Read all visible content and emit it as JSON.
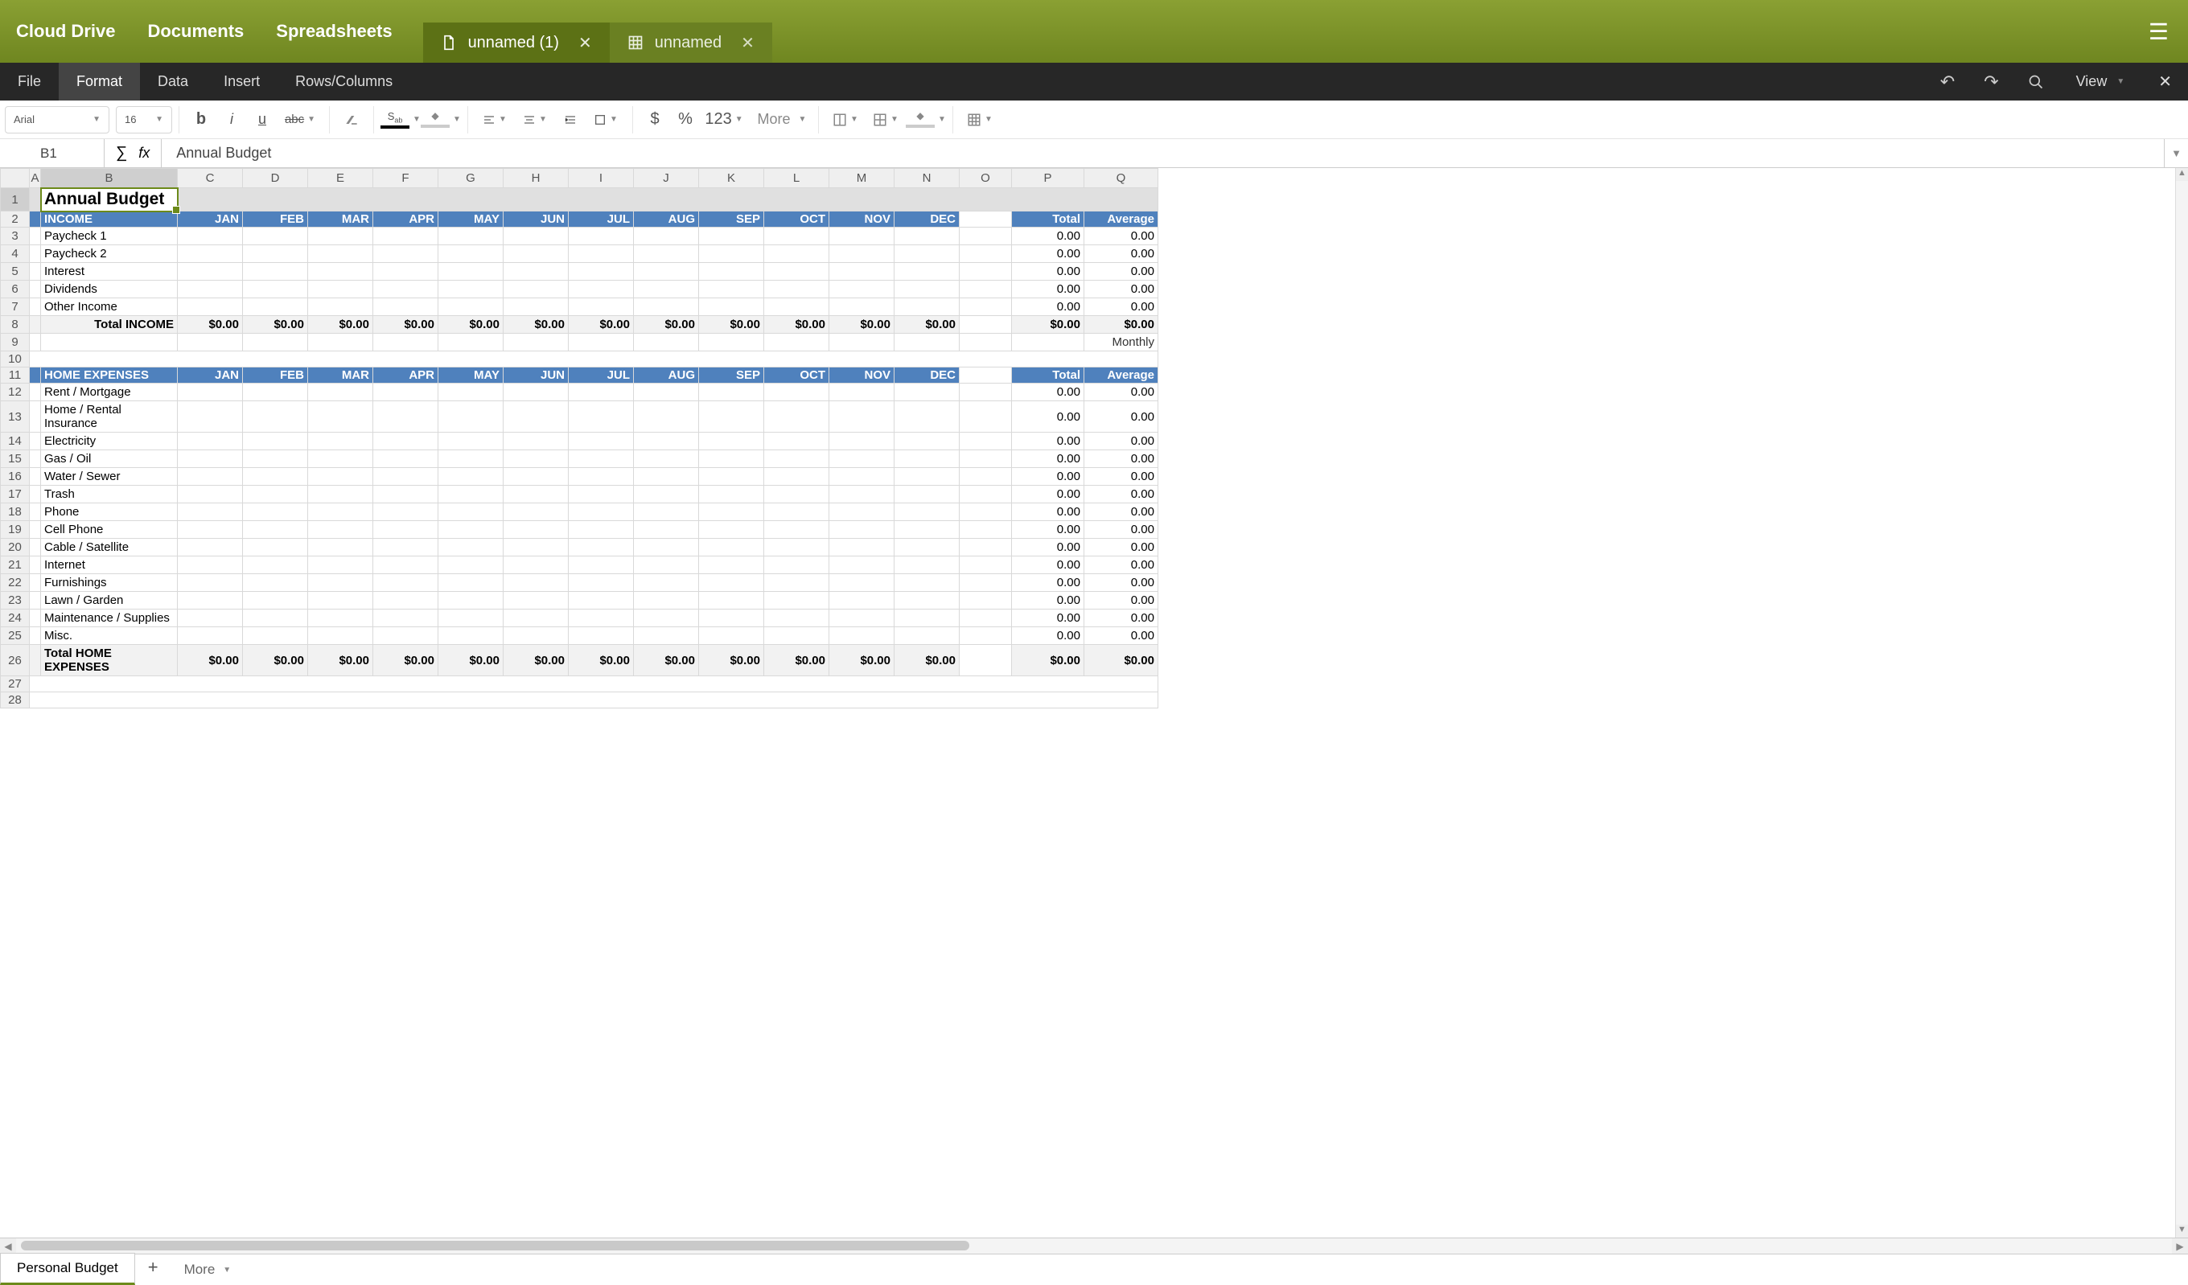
{
  "appbar": {
    "links": [
      "Cloud Drive",
      "Documents",
      "Spreadsheets"
    ],
    "tabs": [
      {
        "label": "unnamed (1)",
        "type": "doc",
        "active": true
      },
      {
        "label": "unnamed",
        "type": "sheet",
        "active": false
      }
    ]
  },
  "menubar": {
    "items": [
      "File",
      "Format",
      "Data",
      "Insert",
      "Rows/Columns"
    ],
    "active_index": 1,
    "view_label": "View"
  },
  "toolbar": {
    "font": "Arial",
    "font_size": "16",
    "numfmt": "123",
    "more_label": "More"
  },
  "formula_bar": {
    "cell_ref": "B1",
    "value": "Annual Budget"
  },
  "columns": [
    "A",
    "B",
    "C",
    "D",
    "E",
    "F",
    "G",
    "H",
    "I",
    "J",
    "K",
    "L",
    "M",
    "N",
    "O",
    "P",
    "Q"
  ],
  "months": [
    "JAN",
    "FEB",
    "MAR",
    "APR",
    "MAY",
    "JUN",
    "JUL",
    "AUG",
    "SEP",
    "OCT",
    "NOV",
    "DEC"
  ],
  "summary_headers": {
    "total": "Total",
    "average": "Average"
  },
  "sheet": {
    "title": "Annual Budget",
    "income": {
      "header": "INCOME",
      "rows": [
        "Paycheck 1",
        "Paycheck 2",
        "Interest",
        "Dividends",
        "Other Income"
      ],
      "total_label": "Total INCOME",
      "monthly_label": "Monthly"
    },
    "home_expenses": {
      "header": "HOME EXPENSES",
      "rows": [
        "Rent / Mortgage",
        "Home / Rental Insurance",
        "Electricity",
        "Gas / Oil",
        "Water / Sewer",
        "Trash",
        "Phone",
        "Cell Phone",
        "Cable / Satellite",
        "Internet",
        "Furnishings",
        "Lawn / Garden",
        "Maintenance / Supplies",
        "Misc."
      ],
      "total_label": "Total HOME EXPENSES"
    },
    "zero_plain": "0.00",
    "zero_dollar": "$0.00"
  },
  "footer": {
    "sheet_name": "Personal Budget",
    "more_label": "More"
  }
}
